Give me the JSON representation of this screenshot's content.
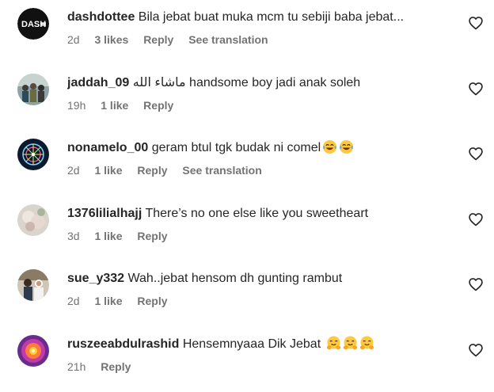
{
  "comments": [
    {
      "username": "dashdottee",
      "text": "Bila jebat buat muka mcm tu sebiji baba jebat...",
      "time": "2d",
      "likes": "3 likes",
      "reply": "Reply",
      "translate": "See translation",
      "avatar_text": "DASH",
      "emojis": []
    },
    {
      "username": "jaddah_09",
      "text": "ماشاء الله handsome boy jadi anak soleh",
      "time": "19h",
      "likes": "1 like",
      "reply": "Reply",
      "translate": "",
      "emojis": []
    },
    {
      "username": "nonamelo_00",
      "text": "geram btul tgk budak ni comel",
      "time": "2d",
      "likes": "1 like",
      "reply": "Reply",
      "translate": "See translation",
      "emojis": [
        "tears-of-joy-emoji",
        "tears-of-joy-emoji"
      ]
    },
    {
      "username": "1376lilialhajj",
      "text": "There’s no one else like you sweetheart",
      "time": "3d",
      "likes": "1 like",
      "reply": "Reply",
      "translate": "",
      "emojis": []
    },
    {
      "username": "sue_y332",
      "text": "Wah..jebat hensom dh gunting rambut",
      "time": "2d",
      "likes": "1 like",
      "reply": "Reply",
      "translate": "",
      "emojis": []
    },
    {
      "username": "ruszeeabdulrashid",
      "text": "Hensemnyaaa Dik Jebat",
      "time": "21h",
      "likes": "",
      "reply": "Reply",
      "translate": "",
      "emojis": [
        "hugging-face-emoji",
        "hugging-face-emoji",
        "hugging-face-emoji"
      ]
    }
  ],
  "colors": {
    "text": "#262626",
    "meta": "#737373",
    "background": "#ffffff",
    "emoji_yellow": "#FFC83D",
    "tear_blue": "#5DADEC"
  }
}
